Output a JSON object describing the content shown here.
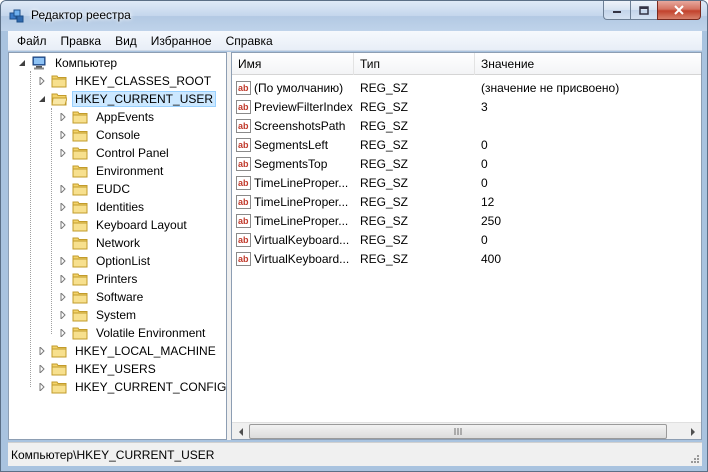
{
  "window": {
    "title": "Редактор реестра"
  },
  "menu": [
    "Файл",
    "Правка",
    "Вид",
    "Избранное",
    "Справка"
  ],
  "tree": {
    "root": "Компьютер",
    "nodes": [
      "HKEY_CLASSES_ROOT",
      "HKEY_CURRENT_USER",
      "AppEvents",
      "Console",
      "Control Panel",
      "Environment",
      "EUDC",
      "Identities",
      "Keyboard Layout",
      "Network",
      "OptionList",
      "Printers",
      "Software",
      "System",
      "Volatile Environment",
      "HKEY_LOCAL_MACHINE",
      "HKEY_USERS",
      "HKEY_CURRENT_CONFIG"
    ],
    "selected": "HKEY_CURRENT_USER"
  },
  "list": {
    "headers": [
      "Имя",
      "Тип",
      "Значение"
    ],
    "rows": [
      {
        "name": "(По умолчанию)",
        "type": "REG_SZ",
        "value": "(значение не присвоено)"
      },
      {
        "name": "PreviewFilterIndex",
        "type": "REG_SZ",
        "value": "3"
      },
      {
        "name": "ScreenshotsPath",
        "type": "REG_SZ",
        "value": ""
      },
      {
        "name": "SegmentsLeft",
        "type": "REG_SZ",
        "value": "0"
      },
      {
        "name": "SegmentsTop",
        "type": "REG_SZ",
        "value": "0"
      },
      {
        "name": "TimeLineProper...",
        "type": "REG_SZ",
        "value": "0"
      },
      {
        "name": "TimeLineProper...",
        "type": "REG_SZ",
        "value": "12"
      },
      {
        "name": "TimeLineProper...",
        "type": "REG_SZ",
        "value": "250"
      },
      {
        "name": "VirtualKeyboard...",
        "type": "REG_SZ",
        "value": "0"
      },
      {
        "name": "VirtualKeyboard...",
        "type": "REG_SZ",
        "value": "400"
      }
    ]
  },
  "status": {
    "path": "Компьютер\\HKEY_CURRENT_USER"
  },
  "colors": {
    "accent": "#a9c3df",
    "selection": "#cce8ff",
    "folder": "#f3d36b",
    "close": "#c2422c"
  }
}
